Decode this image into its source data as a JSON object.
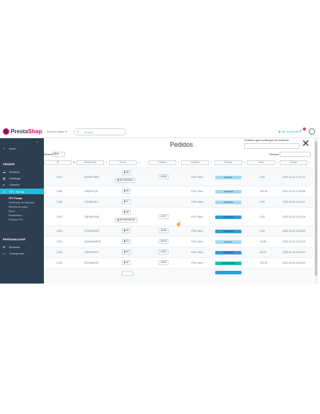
{
  "header": {
    "logo_prefix": "Presta",
    "logo_suffix": "Shop",
    "version": "1.7.6",
    "quick_access": "Acceso rápido ▾",
    "search_placeholder": "Buscar",
    "view_shop": "◉ Ver mi tienda ▾",
    "notifications_count": "3"
  },
  "sidebar": {
    "dashboard": "Inicio",
    "section_sell": "VENDER",
    "items": [
      {
        "icon": "credit-card-icon",
        "label": "Pedidos"
      },
      {
        "icon": "store-icon",
        "label": "Catálogo"
      },
      {
        "icon": "user-icon",
        "label": "Clientes"
      },
      {
        "icon": "tpv-icon",
        "label": "TPV Tienda"
      }
    ],
    "sub_items": [
      "TPV Tienda",
      "Generador de etiquetas",
      "Historial de cajas",
      "Stock",
      "Estadísticas",
      "Pedidos TPV"
    ],
    "section_custom": "PERSONALIZAR",
    "custom_items": [
      {
        "icon": "puzzle-icon",
        "label": "Módulos"
      },
      {
        "icon": "monitor-icon",
        "label": "Transportes"
      }
    ]
  },
  "modal": {
    "title": "Pedidos",
    "product_filter_label": "Pedidos que contengan el producto",
    "show_label": "Mostrar",
    "show_value": "50 ▾",
    "search_label": "Buscar:",
    "close_symbol": "✕",
    "columns": [
      "ID",
      "Referencia",
      "Envío",
      "Factura",
      "Nombre",
      "Estado",
      "Total",
      "Fecha"
    ]
  },
  "orders": [
    {
      "id": "2157",
      "ref": "DJGEEYBBP",
      "envio": "#5",
      "envio2": "DEVMOD01",
      "factura": "#148",
      "nombre": "POS Store",
      "estado": "Enviado",
      "estado_color": "#a4dbf0",
      "total": "0.00",
      "fecha": "2022-10-24 17:27:41"
    },
    {
      "id": "2156",
      "ref": "LHNGPYQE",
      "envio": "#6",
      "envio2": "",
      "factura": "",
      "nombre": "POS Store",
      "estado": "Pendiente",
      "estado_color": "#a4dbf0",
      "total": "262.26",
      "fecha": "2022-10-24 11:35:58"
    },
    {
      "id": "2155",
      "ref": "YGOSDUEZ",
      "envio": "#7",
      "envio2": "",
      "factura": "",
      "nombre": "POS Store",
      "estado": "Pendiente",
      "estado_color": "#a4dbf0",
      "total": "3.98",
      "fecha": "2022-10-24 11:34:12"
    },
    {
      "id": "2153",
      "ref": "QBLWKZSWI",
      "envio": "#8",
      "envio2": "DEVMOD01B",
      "factura": "#147",
      "nombre": "POS Store",
      "estado": "Entregado",
      "estado_color": "#2f9fdb",
      "total": "0.00",
      "fecha": "2022-10-22 13:31:55"
    },
    {
      "id": "2152",
      "ref": "LYGHNOZHP",
      "envio": "#5",
      "envio2": "",
      "factura": "#145",
      "nombre": "POS Store",
      "estado": "Entregado",
      "estado_color": "#2f9fdb",
      "total": "0.00",
      "fecha": "2022-10-22 13:28:29"
    },
    {
      "id": "2151",
      "ref": "QENWNBRHE",
      "envio": "#3",
      "envio2": "",
      "factura": "#143",
      "nombre": "POS Store",
      "estado": "Enviado",
      "estado_color": "#a4dbf0",
      "total": "10.00",
      "fecha": "2022-10-22 13:27:29"
    },
    {
      "id": "2130",
      "ref": "CNROH07V7",
      "envio": "#3",
      "envio2": "",
      "factura": "#122",
      "nombre": "POS Store",
      "estado": "Entregado",
      "estado_color": "#2f9fdb",
      "total": "46.75",
      "fecha": "2022-10-18 10:07:10"
    },
    {
      "id": "2125",
      "ref": "IRVOAEDOZ",
      "envio": "#2",
      "envio2": "",
      "factura": "#120",
      "nombre": "POS Store",
      "estado": "Pago aceptado",
      "estado_color": "#10c7a5",
      "total": "190.01",
      "fecha": "2022-10-06 18:38:22"
    }
  ]
}
